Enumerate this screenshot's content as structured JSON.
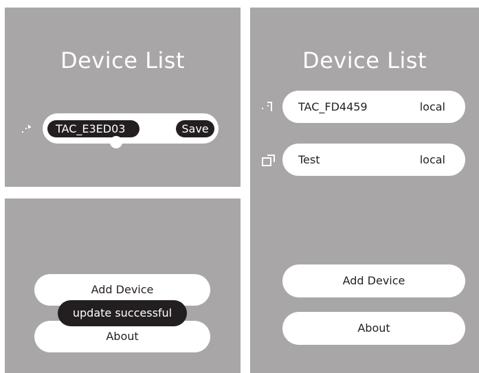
{
  "screen_a": {
    "title": "Device List",
    "edit_value": "TAC_E3ED03",
    "save_label": "Save",
    "icon": "wifi-signal-icon"
  },
  "screen_b": {
    "add_device_label": "Add Device",
    "toast_text": "update successful",
    "about_label": "About"
  },
  "screen_c": {
    "title": "Device List",
    "devices": [
      {
        "name": "TAC_FD4459",
        "status": "local",
        "icon": "wifi-signal-icon"
      },
      {
        "name": "Test",
        "status": "local",
        "icon": "device-box-icon"
      }
    ],
    "add_device_label": "Add Device",
    "about_label": "About"
  },
  "colors": {
    "panel_bg": "#a8a6a7",
    "dark": "#231f20",
    "white": "#ffffff"
  }
}
